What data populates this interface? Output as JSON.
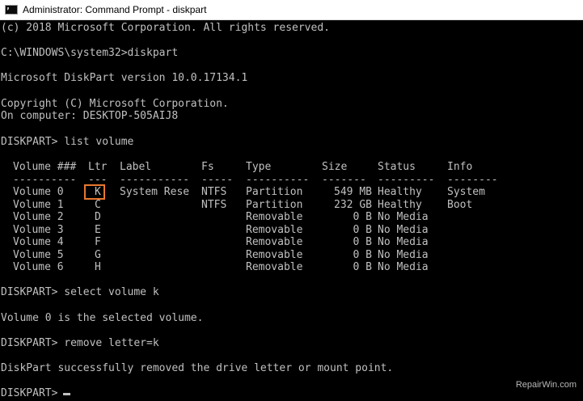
{
  "window": {
    "title": "Administrator: Command Prompt - diskpart"
  },
  "console": {
    "copyright_line": "(c) 2018 Microsoft Corporation. All rights reserved.",
    "prompt_cmd1": "C:\\WINDOWS\\system32>diskpart",
    "version_line": "Microsoft DiskPart version 10.0.17134.1",
    "copyright2": "Copyright (C) Microsoft Corporation.",
    "computer_line": "On computer: DESKTOP-505AIJ8",
    "cmd_list": "DISKPART> list volume",
    "cmd_select": "DISKPART> select volume k",
    "selected_msg": "Volume 0 is the selected volume.",
    "cmd_remove": "DISKPART> remove letter=k",
    "removed_msg": "DiskPart successfully removed the drive letter or mount point.",
    "final_prompt": "DISKPART> "
  },
  "table": {
    "headers": [
      "Volume ###",
      "Ltr",
      "Label",
      "Fs",
      "Type",
      "Size",
      "Status",
      "Info"
    ],
    "separators": [
      "----------",
      "---",
      "-----------",
      "-----",
      "----------",
      "-------",
      "---------",
      "--------"
    ],
    "rows": [
      [
        "Volume 0",
        "K",
        "System Rese",
        "NTFS",
        "Partition",
        "549 MB",
        "Healthy",
        "System"
      ],
      [
        "Volume 1",
        "C",
        "",
        "NTFS",
        "Partition",
        "232 GB",
        "Healthy",
        "Boot"
      ],
      [
        "Volume 2",
        "D",
        "",
        "",
        "Removable",
        "0 B",
        "No Media",
        ""
      ],
      [
        "Volume 3",
        "E",
        "",
        "",
        "Removable",
        "0 B",
        "No Media",
        ""
      ],
      [
        "Volume 4",
        "F",
        "",
        "",
        "Removable",
        "0 B",
        "No Media",
        ""
      ],
      [
        "Volume 5",
        "G",
        "",
        "",
        "Removable",
        "0 B",
        "No Media",
        ""
      ],
      [
        "Volume 6",
        "H",
        "",
        "",
        "Removable",
        "0 B",
        "No Media",
        ""
      ]
    ]
  },
  "watermark": "RepairWin.com",
  "colors": {
    "console_bg": "#000000",
    "console_text": "#c0c0c0",
    "highlight": "#e8772e"
  }
}
